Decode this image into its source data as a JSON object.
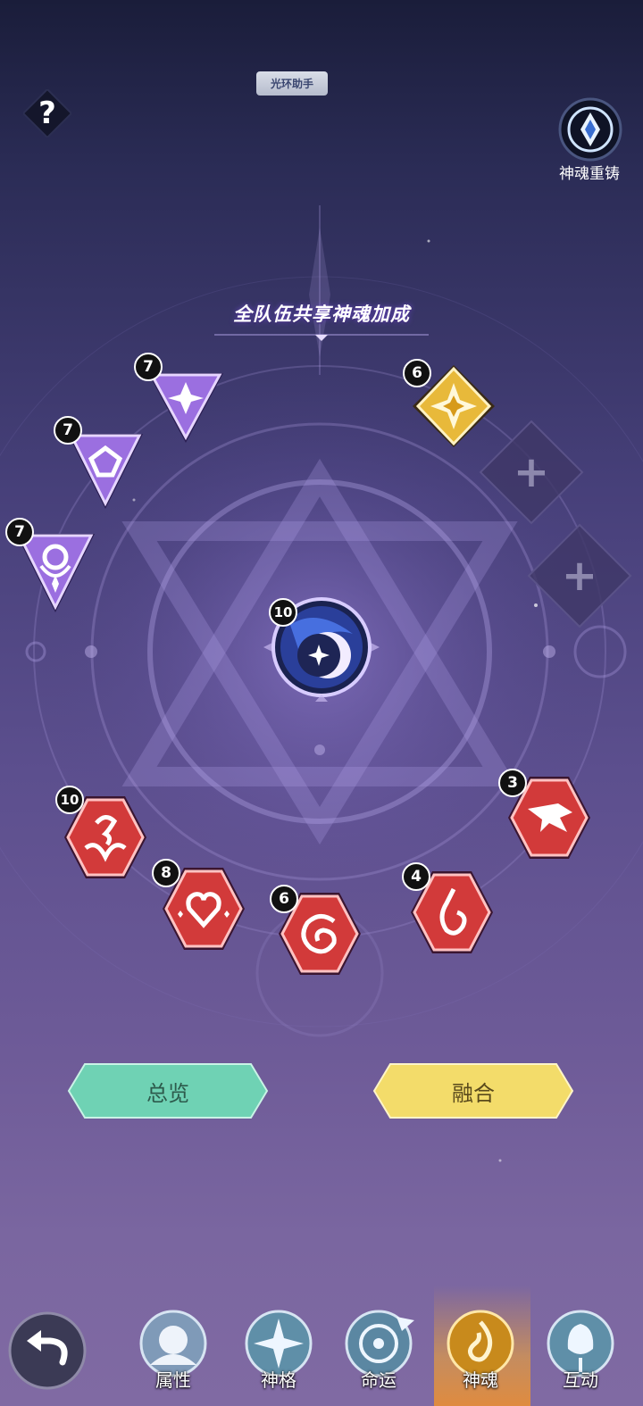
{
  "helper_tab": {
    "label": "光环助手"
  },
  "help_button": {
    "label": "?"
  },
  "reforge": {
    "label": "神魂重铸"
  },
  "banner": {
    "title": "全队伍共享神魂加成"
  },
  "souls": {
    "purple_top": {
      "level": "7"
    },
    "purple_mid": {
      "level": "7"
    },
    "purple_low": {
      "level": "7"
    },
    "gold": {
      "level": "6"
    },
    "core": {
      "level": "10"
    },
    "red_1": {
      "level": "10"
    },
    "red_2": {
      "level": "8"
    },
    "red_3": {
      "level": "6"
    },
    "red_4": {
      "level": "4"
    },
    "red_5": {
      "level": "3"
    }
  },
  "empty_slots": {
    "plus": "+"
  },
  "buttons": {
    "overview": "总览",
    "fusion": "融合"
  },
  "nav": {
    "items": [
      {
        "label": "属性"
      },
      {
        "label": "神格"
      },
      {
        "label": "命运"
      },
      {
        "label": "神魂"
      },
      {
        "label": "互动"
      }
    ],
    "active_index": 3
  },
  "colors": {
    "purple_gem": "#9b6fe0",
    "gold_gem": "#e8b93a",
    "red_gem": "#d23a3a",
    "overview_button": "#6fd2b4",
    "fusion_button": "#f3dc6a"
  }
}
